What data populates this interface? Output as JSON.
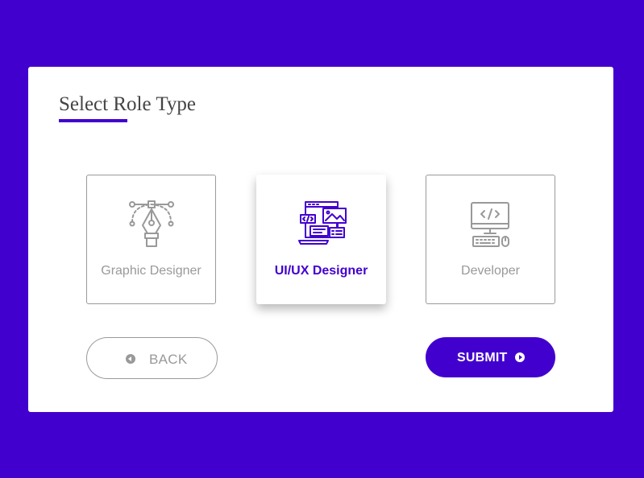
{
  "page": {
    "title": "Select Role Type"
  },
  "roles": [
    {
      "label": "Graphic Designer",
      "icon": "pen-tool-icon",
      "selected": false
    },
    {
      "label": "UI/UX Designer",
      "icon": "ui-design-icon",
      "selected": true
    },
    {
      "label": "Developer",
      "icon": "computer-code-icon",
      "selected": false
    }
  ],
  "buttons": {
    "back_label": "BACK",
    "submit_label": "SUBMIT"
  },
  "colors": {
    "background": "#4200cf",
    "accent": "#4200cf",
    "muted": "#999999",
    "card": "#ffffff"
  }
}
